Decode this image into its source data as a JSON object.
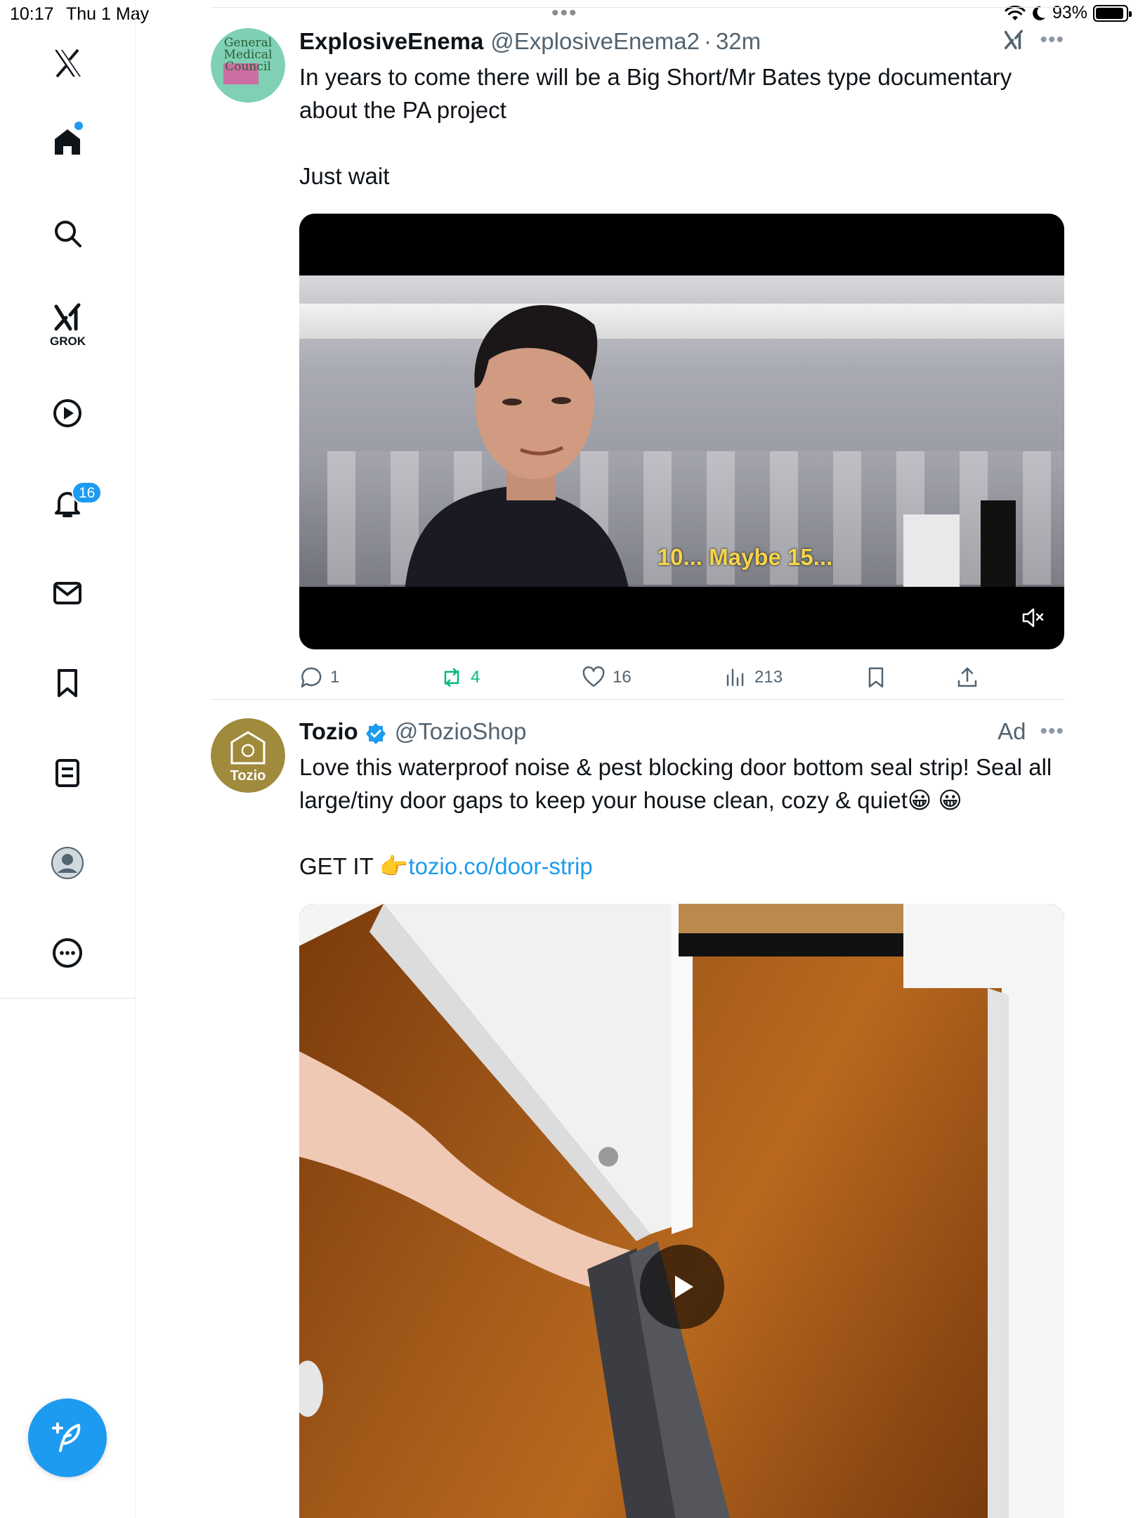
{
  "status_bar": {
    "time": "10:17",
    "date": "Thu 1 May",
    "dots": "•••",
    "battery": "93%",
    "battery_level": 0.93
  },
  "sidebar": {
    "grok_label": "GROK",
    "notifications_badge": "16",
    "items": [
      "x-logo",
      "home",
      "search",
      "grok",
      "video",
      "notifications",
      "messages",
      "bookmarks",
      "lists",
      "profile",
      "more"
    ]
  },
  "posts": [
    {
      "author": "ExplosiveEnema",
      "handle": "@ExplosiveEnema2",
      "separator": "·",
      "time": "32m",
      "text": "In years to come there will be a Big Short/Mr Bates type documentary about the PA project\n\nJust wait",
      "avatar_text": [
        "General",
        "Medical",
        "Council"
      ],
      "video_subtitle": "10... Maybe 15...",
      "actions": {
        "replies": "1",
        "reposts": "4",
        "likes": "16",
        "views": "213"
      }
    },
    {
      "author": "Tozio",
      "handle": "@TozioShop",
      "ad_label": "Ad",
      "text_line": "Love this waterproof noise & pest blocking door bottom seal strip! Seal all large/tiny door gaps to keep your house clean, cozy & quiet😀 😀",
      "cta_prefix": "GET IT 👉",
      "link": "tozio.co/door-strip",
      "avatar_text": "Tozio"
    }
  ],
  "colors": {
    "accent": "#1d9bf0",
    "repost_green": "#00ba7c",
    "muted_text": "#536471"
  }
}
